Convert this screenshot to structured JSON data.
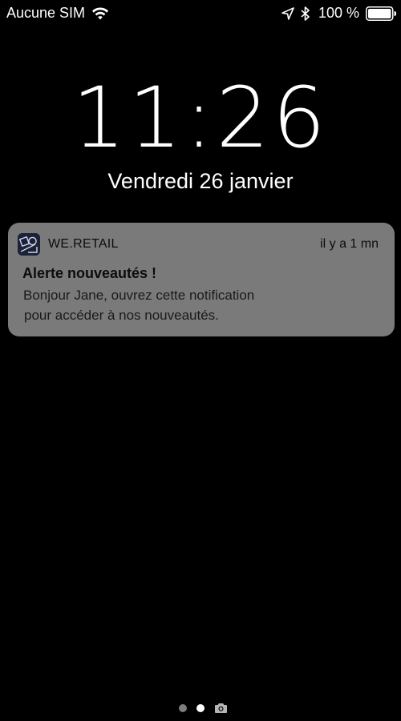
{
  "status_bar": {
    "carrier": "Aucune SIM",
    "battery_percent": "100 %",
    "battery_level": 1.0,
    "icons": [
      "wifi-icon",
      "location-arrow-icon",
      "bluetooth-icon",
      "battery-icon"
    ]
  },
  "lock_screen": {
    "time": "11:26",
    "date": "Vendredi 26 janvier"
  },
  "notification": {
    "app_icon": "we-retail-app-icon",
    "app_name": "WE.RETAIL",
    "time_ago": "il y a 1 mn",
    "title": "Alerte nouveautés !",
    "body_line1": "Bonjour Jane, ouvrez cette notification",
    "body_line2": "pour accéder à nos nouveautés."
  },
  "page_indicator": {
    "pages": 2,
    "current_page": 2,
    "trailing_icon": "camera-icon"
  },
  "colors": {
    "background": "#000000",
    "notification_bg": "#7a7a7a",
    "text_primary": "#ffffff",
    "notification_text": "#0c0c0c"
  }
}
